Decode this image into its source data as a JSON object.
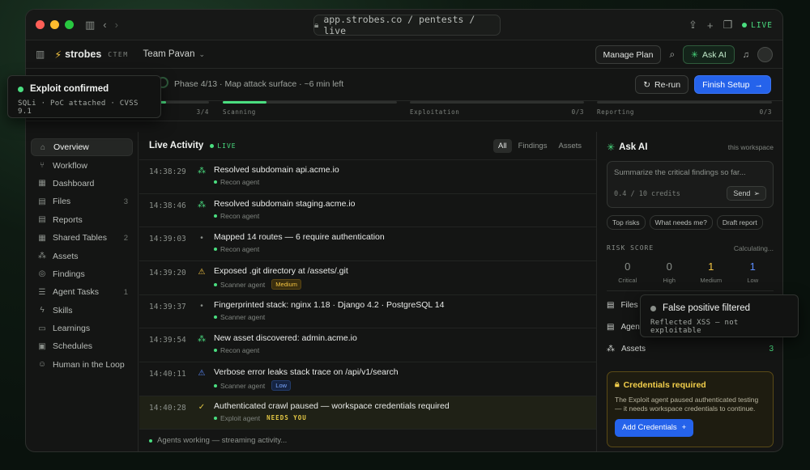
{
  "browser": {
    "url": "app.strobes.co / pentests / live",
    "live_label": "LIVE"
  },
  "app": {
    "brand": "strobes",
    "brand_tag": "CTEM",
    "team": "Team Pavan",
    "manage_plan": "Manage Plan",
    "ask_ai": "Ask AI"
  },
  "phase": {
    "text": "Phase 4/13 · Map attack surface · ~6 min left",
    "rerun": "Re-run",
    "finish": "Finish Setup",
    "progress": 0.31
  },
  "stages": [
    {
      "name": "Recon & Setup",
      "count": "3/4",
      "progress": 0.75
    },
    {
      "name": "Scanning",
      "count": "",
      "progress": 0.25
    },
    {
      "name": "Exploitation",
      "count": "0/3",
      "progress": 0
    },
    {
      "name": "Reporting",
      "count": "0/3",
      "progress": 0
    }
  ],
  "sidebar": {
    "items": [
      {
        "label": "Overview",
        "icon": "home-icon",
        "glyph": "⌂",
        "count": ""
      },
      {
        "label": "Workflow",
        "icon": "workflow-icon",
        "glyph": "⑂",
        "count": ""
      },
      {
        "label": "Dashboard",
        "icon": "dashboard-icon",
        "glyph": "▦",
        "count": ""
      },
      {
        "label": "Files",
        "icon": "file-icon",
        "glyph": "▤",
        "count": "3"
      },
      {
        "label": "Reports",
        "icon": "report-icon",
        "glyph": "▤",
        "count": ""
      },
      {
        "label": "Shared Tables",
        "icon": "table-icon",
        "glyph": "▦",
        "count": "2"
      },
      {
        "label": "Assets",
        "icon": "assets-icon",
        "glyph": "⁂",
        "count": ""
      },
      {
        "label": "Findings",
        "icon": "findings-icon",
        "glyph": "◎",
        "count": ""
      },
      {
        "label": "Agent Tasks",
        "icon": "tasks-icon",
        "glyph": "☰",
        "count": "1"
      },
      {
        "label": "Skills",
        "icon": "skills-icon",
        "glyph": "ϟ",
        "count": ""
      },
      {
        "label": "Learnings",
        "icon": "book-icon",
        "glyph": "▭",
        "count": ""
      },
      {
        "label": "Schedules",
        "icon": "calendar-icon",
        "glyph": "▣",
        "count": ""
      },
      {
        "label": "Human in the Loop",
        "icon": "human-icon",
        "glyph": "☺",
        "count": ""
      }
    ]
  },
  "activity": {
    "title": "Live Activity",
    "live": "LIVE",
    "filters": [
      "All",
      "Findings",
      "Assets"
    ],
    "rows": [
      {
        "time": "14:38:29",
        "title": "Resolved subdomain api.acme.io",
        "agent": "Recon agent",
        "icon": "nodes-icon",
        "glyph": "⁂",
        "color": "#4ade80",
        "badge": "",
        "badge_type": "",
        "needs": ""
      },
      {
        "time": "14:38:46",
        "title": "Resolved subdomain staging.acme.io",
        "agent": "Recon agent",
        "icon": "nodes-icon",
        "glyph": "⁂",
        "color": "#4ade80",
        "badge": "",
        "badge_type": "",
        "needs": ""
      },
      {
        "time": "14:39:03",
        "title": "Mapped 14 routes — 6 require authentication",
        "agent": "Recon agent",
        "icon": "dot-icon",
        "glyph": "•",
        "color": "#8a8f8a",
        "badge": "",
        "badge_type": "",
        "needs": ""
      },
      {
        "time": "14:39:20",
        "title": "Exposed .git directory at /assets/.git",
        "agent": "Scanner agent",
        "icon": "warning-icon",
        "glyph": "⚠",
        "color": "#f5c542",
        "badge": "Medium",
        "badge_type": "medium",
        "needs": ""
      },
      {
        "time": "14:39:37",
        "title": "Fingerprinted stack: nginx 1.18 · Django 4.2 · PostgreSQL 14",
        "agent": "Scanner agent",
        "icon": "dot-icon",
        "glyph": "•",
        "color": "#8a8f8a",
        "badge": "",
        "badge_type": "",
        "needs": ""
      },
      {
        "time": "14:39:54",
        "title": "New asset discovered: admin.acme.io",
        "agent": "Recon agent",
        "icon": "nodes-icon",
        "glyph": "⁂",
        "color": "#4ade80",
        "badge": "",
        "badge_type": "",
        "needs": ""
      },
      {
        "time": "14:40:11",
        "title": "Verbose error leaks stack trace on /api/v1/search",
        "agent": "Scanner agent",
        "icon": "warning-icon",
        "glyph": "⚠",
        "color": "#5b8cff",
        "badge": "Low",
        "badge_type": "low",
        "needs": ""
      },
      {
        "time": "14:40:28",
        "title": "Authenticated crawl paused — workspace credentials required",
        "agent": "Exploit agent",
        "icon": "check-icon",
        "glyph": "✓",
        "color": "#e3c744",
        "badge": "",
        "badge_type": "",
        "needs": "NEEDS YOU"
      }
    ],
    "footer": "Agents working — streaming activity..."
  },
  "ai_panel": {
    "title": "Ask AI",
    "scope": "this workspace",
    "placeholder": "Summarize the critical findings so far...",
    "credits": "0.4 / 10 credits",
    "send": "Send",
    "chips": [
      "Top risks",
      "What needs me?",
      "Draft report"
    ]
  },
  "risk": {
    "label": "RISK SCORE",
    "status": "Calculating...",
    "cells": [
      {
        "value": "0",
        "label": "Critical",
        "color": "#8a8f8a"
      },
      {
        "value": "0",
        "label": "High",
        "color": "#8a8f8a"
      },
      {
        "value": "1",
        "label": "Medium",
        "color": "#f5c542"
      },
      {
        "value": "1",
        "label": "Low",
        "color": "#5b8cff"
      }
    ]
  },
  "stats": [
    {
      "label": "Files",
      "value": "",
      "icon": "file-icon",
      "glyph": "▤"
    },
    {
      "label": "Agents",
      "value": "",
      "icon": "agent-icon",
      "glyph": "▤"
    },
    {
      "label": "Assets",
      "value": "3",
      "icon": "assets-icon",
      "glyph": "⁂"
    }
  ],
  "credentials": {
    "title": "Credentials required",
    "text": "The Exploit agent paused authenticated testing — it needs workspace credentials to continue.",
    "button": "Add Credentials"
  },
  "toasts": {
    "exploit": {
      "title": "Exploit confirmed",
      "sub": "SQLi · PoC attached · CVSS 9.1"
    },
    "false_positive": {
      "title": "False positive filtered",
      "sub": "Reflected XSS — not exploitable"
    }
  }
}
